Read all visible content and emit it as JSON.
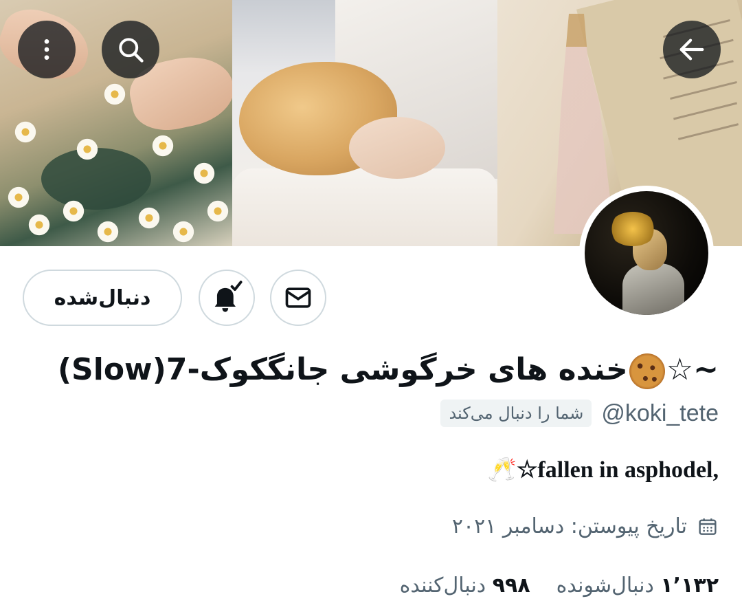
{
  "header": {
    "back_icon": "arrow-left-icon",
    "search_icon": "search-icon",
    "more_icon": "more-vertical-icon"
  },
  "actions": {
    "following_label": "دنبال‌شده",
    "notification_icon": "bell-check-icon",
    "message_icon": "mail-icon"
  },
  "profile": {
    "display_name_prefix": "~☆",
    "display_name_text": "خنده های خرگوشی جانگکوک-7(Slow)",
    "handle": "@koki_tete",
    "follows_you": "شما را دنبال می‌کند",
    "bio_emoji": "🥂",
    "bio_text": "☆fallen in asphodel,",
    "joined": "تاریخ پیوستن: دسامبر ۲۰۲۱",
    "following_count": "۱٬۱۳۲",
    "following_label": "دنبال‌شونده",
    "followers_count": "۹۹۸",
    "followers_label": "دنبال‌کننده"
  },
  "colors": {
    "text_primary": "#0f1419",
    "text_secondary": "#536471",
    "border": "#cfd9de",
    "badge_bg": "#eff3f4"
  }
}
